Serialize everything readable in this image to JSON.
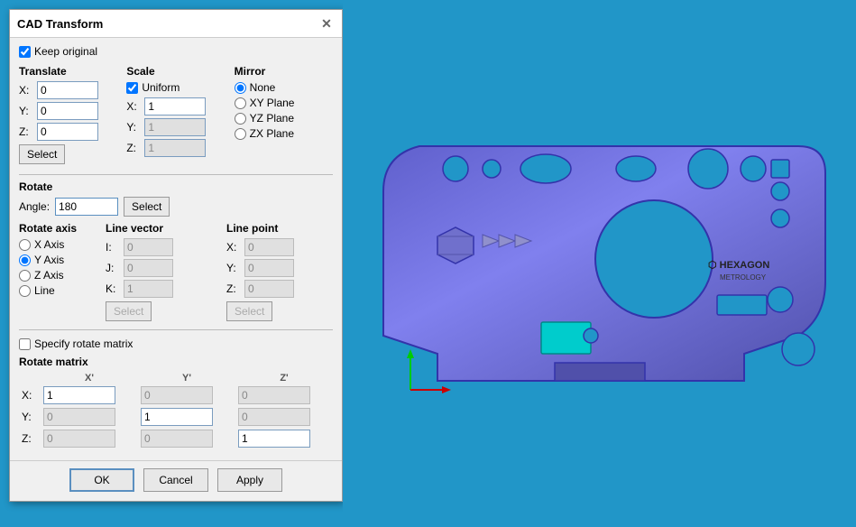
{
  "dialog": {
    "title": "CAD Transform",
    "keep_original_label": "Keep original",
    "keep_original_checked": true,
    "translate": {
      "label": "Translate",
      "x_value": "0",
      "y_value": "0",
      "z_value": "0",
      "select_label": "Select"
    },
    "scale": {
      "label": "Scale",
      "uniform_label": "Uniform",
      "uniform_checked": true,
      "x_value": "1",
      "y_value": "1",
      "z_value": "1"
    },
    "mirror": {
      "label": "Mirror",
      "options": [
        "None",
        "XY Plane",
        "YZ Plane",
        "ZX Plane"
      ],
      "selected": "None"
    },
    "rotate": {
      "label": "Rotate",
      "angle_label": "Angle:",
      "angle_value": "180",
      "select_label": "Select",
      "rotate_axis_label": "Rotate axis",
      "axes": [
        "X Axis",
        "Y Axis",
        "Z Axis",
        "Line"
      ],
      "selected_axis": "Y Axis",
      "line_vector_label": "Line vector",
      "lv_i_label": "I:",
      "lv_i_value": "0",
      "lv_j_label": "J:",
      "lv_j_value": "0",
      "lv_k_label": "K:",
      "lv_k_value": "1",
      "lv_select": "Select",
      "line_point_label": "Line point",
      "lp_x_label": "X:",
      "lp_x_value": "0",
      "lp_y_label": "Y:",
      "lp_y_value": "0",
      "lp_z_label": "Z:",
      "lp_z_value": "0",
      "lp_select": "Select"
    },
    "specify_matrix_label": "Specify rotate matrix",
    "specify_matrix_checked": false,
    "rotate_matrix_label": "Rotate matrix",
    "matrix": {
      "col_x": "X'",
      "col_y": "Y'",
      "col_z": "Z'",
      "rows": [
        {
          "label": "X:",
          "x": "1",
          "y": "0",
          "z": "0"
        },
        {
          "label": "Y:",
          "x": "0",
          "y": "1",
          "z": "0"
        },
        {
          "label": "Z:",
          "x": "0",
          "y": "0",
          "z": "1"
        }
      ]
    },
    "ok_label": "OK",
    "cancel_label": "Cancel",
    "apply_label": "Apply"
  }
}
